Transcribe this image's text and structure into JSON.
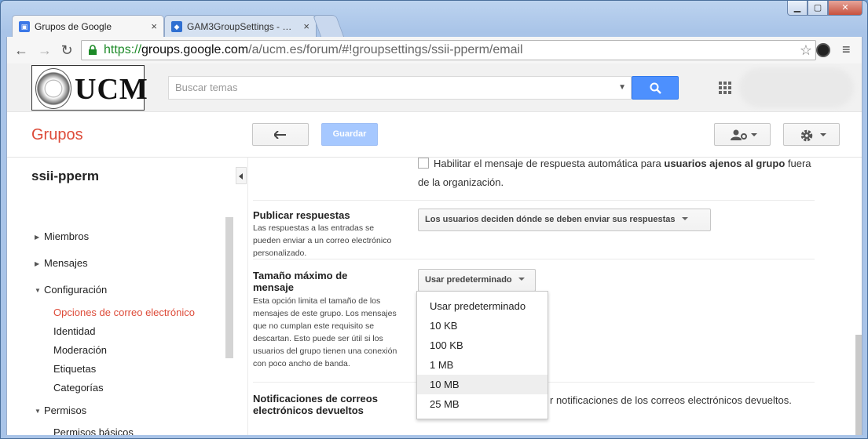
{
  "browser": {
    "tabs": [
      {
        "title": "Grupos de Google",
        "icon": "google-groups-icon"
      },
      {
        "title": "GAM3GroupSettings - goo",
        "icon": "project-icon"
      }
    ],
    "close_glyph": "×",
    "url": {
      "scheme": "https://",
      "host": "groups.google.com",
      "path": "/a/ucm.es/forum/#!groupsettings/ssii-pperm/email"
    }
  },
  "header": {
    "logo_text": "UCM",
    "search_placeholder": "Buscar temas"
  },
  "actionbar": {
    "title": "Grupos",
    "save_label": "Guardar"
  },
  "sidebar": {
    "group_name": "ssii-pperm",
    "items": [
      {
        "label": "Miembros"
      },
      {
        "label": "Mensajes"
      },
      {
        "label": "Configuración"
      }
    ],
    "config_subitems": [
      {
        "label": "Opciones de correo electrónico",
        "active": true
      },
      {
        "label": "Identidad"
      },
      {
        "label": "Moderación"
      },
      {
        "label": "Etiquetas"
      },
      {
        "label": "Categorías"
      }
    ],
    "permissions": {
      "label": "Permisos",
      "subitems": [
        {
          "label": "Permisos básicos"
        }
      ]
    }
  },
  "main": {
    "autoreply": {
      "prefix": "Habilitar el mensaje de respuesta automática para ",
      "bold": "usuarios ajenos al grupo",
      "suffix": " fuera",
      "line2": "de la organización."
    },
    "publish_replies": {
      "label": "Publicar respuestas",
      "description": "Las respuestas a las entradas se pueden enviar a un correo electrónico personalizado.",
      "value": "Los usuarios deciden dónde se deben enviar sus respuestas"
    },
    "max_size": {
      "label_line1": "Tamaño máximo de",
      "label_line2": "mensaje",
      "description": "Esta opción limita el tamaño de los mensajes de este grupo. Los mensajes que no cumplan este requisito se descartan. Esto puede ser útil si los usuarios del grupo tienen una conexión con poco ancho de banda.",
      "value": "Usar predeterminado",
      "options": [
        "Usar predeterminado",
        "10 KB",
        "100 KB",
        "1 MB",
        "10 MB",
        "25 MB"
      ],
      "hovered_option": "10 MB"
    },
    "bounce": {
      "label_line1": "Notificaciones de correos",
      "label_line2": "electrónicos devueltos",
      "text": "r notificaciones de los correos electrónicos devueltos."
    }
  },
  "colors": {
    "brand_red": "#dd4b39",
    "search_blue": "#4d90fe",
    "save_disabled": "#a6c8ff",
    "secure_green": "#1d8a28"
  }
}
